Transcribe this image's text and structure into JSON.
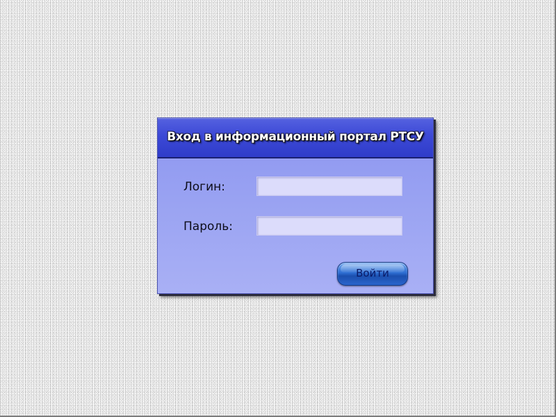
{
  "login_panel": {
    "title": "Вход в информационный портал РТСУ",
    "login_label": "Логин:",
    "login_value": "",
    "password_label": "Пароль:",
    "password_value": "",
    "submit_label": "Войти"
  }
}
